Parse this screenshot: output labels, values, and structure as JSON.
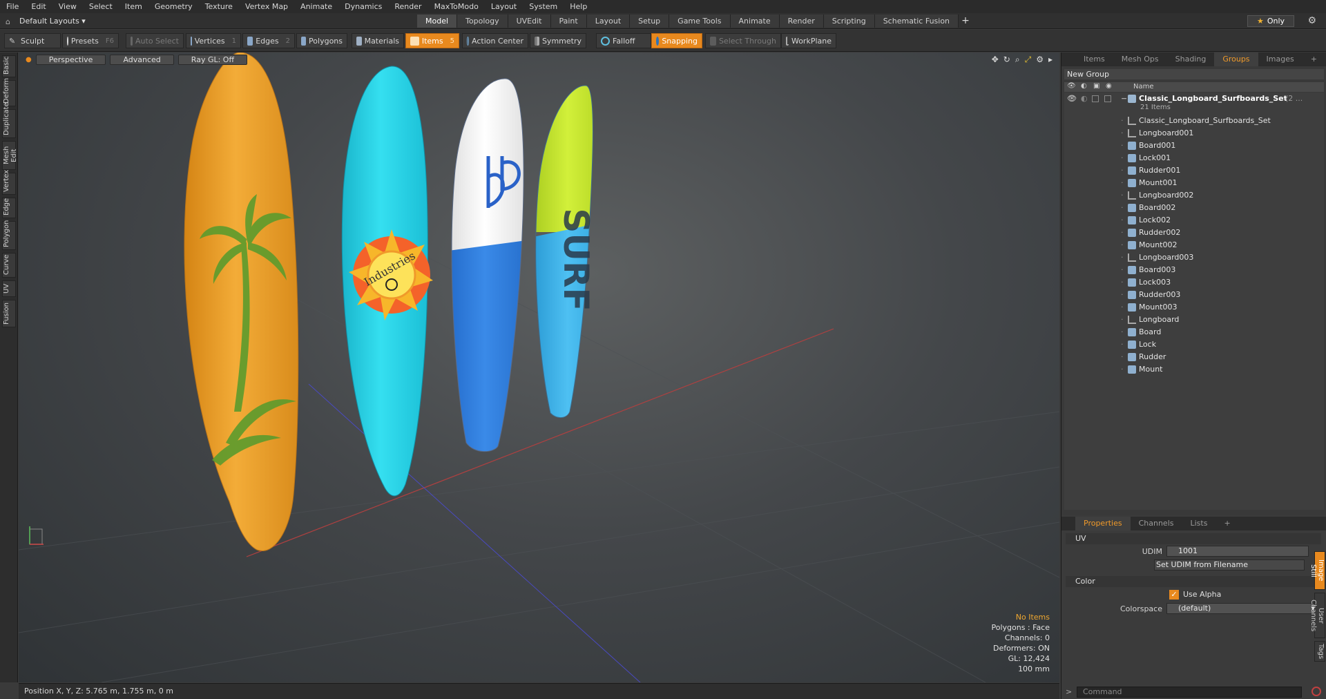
{
  "menu": [
    "File",
    "Edit",
    "View",
    "Select",
    "Item",
    "Geometry",
    "Texture",
    "Vertex Map",
    "Animate",
    "Dynamics",
    "Render",
    "MaxToModo",
    "Layout",
    "System",
    "Help"
  ],
  "layouts": {
    "label": "Default Layouts ▾"
  },
  "mode_tabs": [
    "Model",
    "Topology",
    "UVEdit",
    "Paint",
    "Layout",
    "Setup",
    "Game Tools",
    "Animate",
    "Render",
    "Scripting",
    "Schematic Fusion"
  ],
  "active_mode": "Model",
  "only_label": "Only",
  "toolbar": {
    "sculpt": "Sculpt",
    "presets": "Presets",
    "presets_key": "F6",
    "auto_select": "Auto Select",
    "vertices": "Vertices",
    "vertices_num": "1",
    "edges": "Edges",
    "edges_num": "2",
    "polygons": "Polygons",
    "materials": "Materials",
    "items": "Items",
    "items_num": "5",
    "action_center": "Action Center",
    "symmetry": "Symmetry",
    "falloff": "Falloff",
    "snapping": "Snapping",
    "select_through": "Select Through",
    "workplane": "WorkPlane"
  },
  "left_tabs": [
    "Basic",
    "Deform",
    "Duplicate",
    "Mesh Edit",
    "Vertex",
    "Edge",
    "Polygon",
    "Curve",
    "UV",
    "Fusion"
  ],
  "viewport": {
    "perspective": "Perspective",
    "advanced": "Advanced",
    "raygl": "Ray GL: Off",
    "info": {
      "no_items": "No Items",
      "polygons": "Polygons : Face",
      "channels": "Channels: 0",
      "deformers": "Deformers: ON",
      "gl": "GL: 12,424",
      "scale": "100 mm"
    }
  },
  "status": {
    "position": "Position X, Y, Z:   5.765 m, 1.755 m, 0 m"
  },
  "panel_tabs": [
    "Items",
    "Mesh Ops",
    "Shading",
    "Groups",
    "Images"
  ],
  "active_panel_tab": "Groups",
  "groups": {
    "new_group": "New Group",
    "col_name": "Name",
    "set_name": "Classic_Longboard_Surfboards_Set",
    "set_suffix": "(2 ...",
    "set_count": "21 Items",
    "items": [
      {
        "name": "Classic_Longboard_Surfboards_Set",
        "type": "locator"
      },
      {
        "name": "Longboard001",
        "type": "locator"
      },
      {
        "name": "Board001",
        "type": "mesh"
      },
      {
        "name": "Lock001",
        "type": "mesh"
      },
      {
        "name": "Rudder001",
        "type": "mesh"
      },
      {
        "name": "Mount001",
        "type": "mesh"
      },
      {
        "name": "Longboard002",
        "type": "locator"
      },
      {
        "name": "Board002",
        "type": "mesh"
      },
      {
        "name": "Lock002",
        "type": "mesh"
      },
      {
        "name": "Rudder002",
        "type": "mesh"
      },
      {
        "name": "Mount002",
        "type": "mesh"
      },
      {
        "name": "Longboard003",
        "type": "locator"
      },
      {
        "name": "Board003",
        "type": "mesh"
      },
      {
        "name": "Lock003",
        "type": "mesh"
      },
      {
        "name": "Rudder003",
        "type": "mesh"
      },
      {
        "name": "Mount003",
        "type": "mesh"
      },
      {
        "name": "Longboard",
        "type": "locator"
      },
      {
        "name": "Board",
        "type": "mesh"
      },
      {
        "name": "Lock",
        "type": "mesh"
      },
      {
        "name": "Rudder",
        "type": "mesh"
      },
      {
        "name": "Mount",
        "type": "mesh"
      }
    ]
  },
  "prop_tabs": [
    "Properties",
    "Channels",
    "Lists"
  ],
  "active_prop_tab": "Properties",
  "props": {
    "uv_section": "UV",
    "udim_label": "UDIM",
    "udim_value": "1001",
    "set_udim": "Set UDIM from Filename",
    "color_section": "Color",
    "use_alpha": "Use Alpha",
    "colorspace_label": "Colorspace",
    "colorspace_value": "(default)"
  },
  "side_vtabs": [
    "Image Still",
    "User Channels",
    "Tags"
  ],
  "command_placeholder": "Command",
  "colors": {
    "accent": "#e8891e",
    "board1": "#f0a42c",
    "board2": "#29d3e3",
    "board3_top": "#f4f4f4",
    "board3_bottom": "#2e7be0",
    "board4_top": "#c4e82a",
    "board4_bottom": "#3cb2ec"
  },
  "board_text": {
    "sun": "Industries",
    "board4": "SURF"
  }
}
